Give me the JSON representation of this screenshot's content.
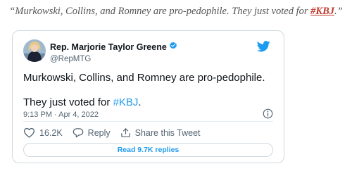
{
  "quote": {
    "open_mark": "“",
    "text": "Murkowski, Collins, and Romney are pro-pedophile. They just voted for ",
    "hashtag": "#KBJ",
    "close": ".”"
  },
  "tweet": {
    "author_name": "Rep. Marjorie Taylor Greene",
    "handle": "@RepMTG",
    "line1": "Murkowski, Collins, and Romney are pro-pedophile.",
    "line2_prefix": "They just voted for ",
    "line2_hashtag": "#KBJ",
    "line2_suffix": ".",
    "timestamp": "9:13 PM · Apr 4, 2022",
    "likes": "16.2K",
    "reply_label": "Reply",
    "share_label": "Share this Tweet",
    "read_replies_label": "Read 9.7K replies"
  },
  "colors": {
    "twitter_blue": "#1d9bf0",
    "quote_link": "#c0392b"
  },
  "icons": [
    "verified-badge-icon",
    "twitter-bird-icon",
    "info-icon",
    "heart-icon",
    "reply-bubble-icon",
    "share-icon"
  ]
}
